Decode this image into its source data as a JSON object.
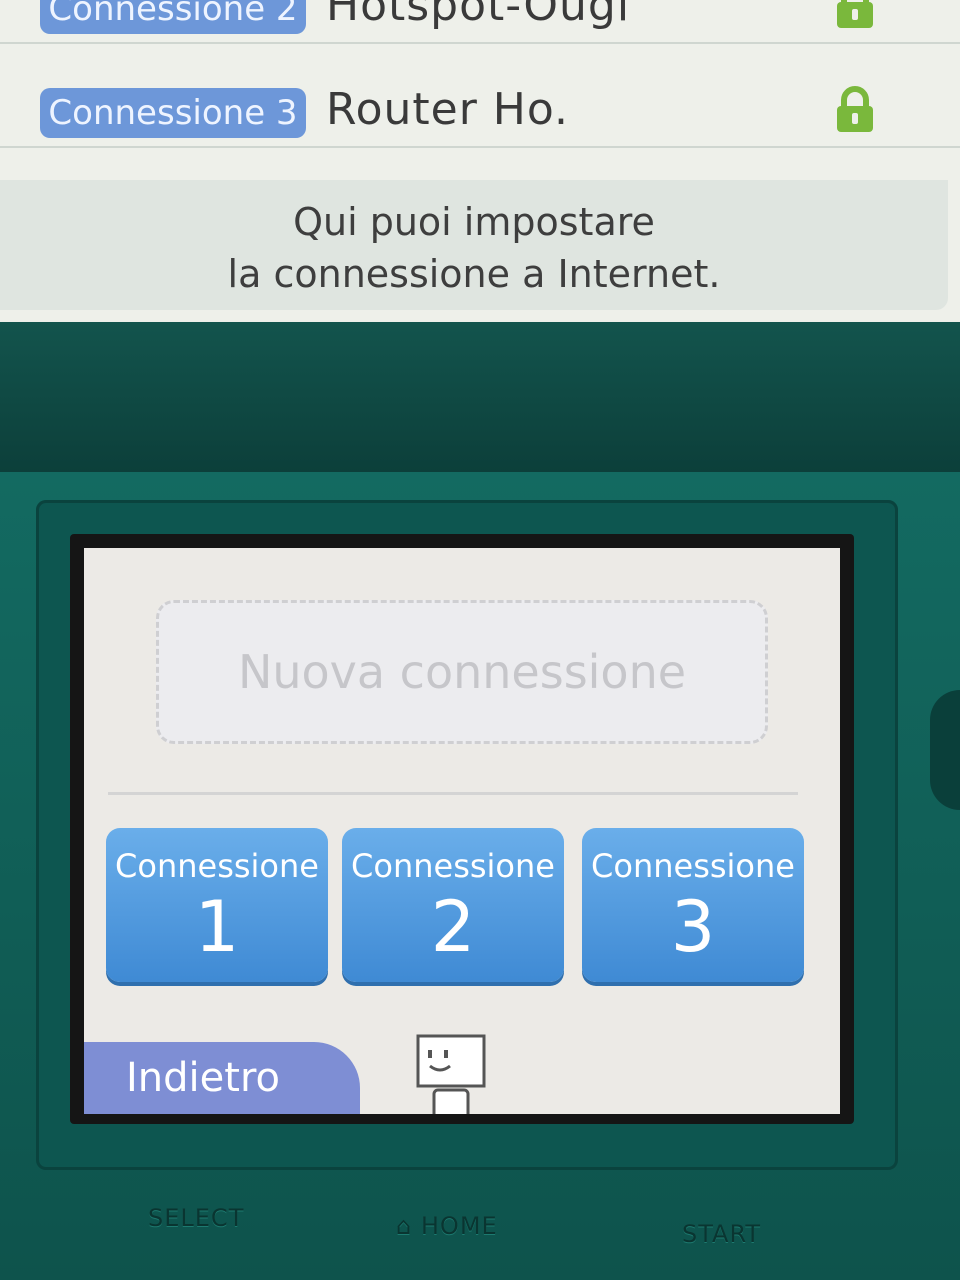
{
  "top_screen": {
    "connections": [
      {
        "tag": "Connessione 2",
        "name": "Hotspot-Ougi",
        "locked": true
      },
      {
        "tag": "Connessione 3",
        "name": "Router Ho.",
        "locked": true
      }
    ],
    "info_line1": "Qui puoi impostare",
    "info_line2": "la connessione a Internet."
  },
  "touch_screen": {
    "new_connection_label": "Nuova connessione",
    "slots": [
      {
        "label": "Connessione",
        "number": "1"
      },
      {
        "label": "Connessione",
        "number": "2"
      },
      {
        "label": "Connessione",
        "number": "3"
      }
    ],
    "back_label": "Indietro"
  },
  "hardware": {
    "select_label": "SELECT",
    "home_label": "HOME",
    "start_label": "START"
  },
  "colors": {
    "tag_blue": "#6d97d9",
    "slot_blue": "#4f9be0",
    "back_purple": "#7e8ed4",
    "lock_green": "#7ab83c",
    "device_teal": "#136a61"
  }
}
